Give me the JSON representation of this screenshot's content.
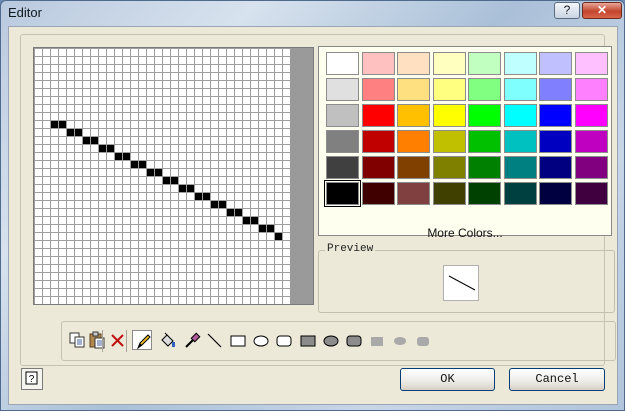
{
  "window": {
    "title": "Editor",
    "help_glyph": "?",
    "close_glyph": "✕"
  },
  "grid": {
    "cols": 32,
    "rows": 32,
    "filled": [
      [
        2,
        9
      ],
      [
        3,
        9
      ],
      [
        4,
        10
      ],
      [
        5,
        10
      ],
      [
        6,
        11
      ],
      [
        7,
        11
      ],
      [
        8,
        12
      ],
      [
        9,
        12
      ],
      [
        10,
        13
      ],
      [
        11,
        13
      ],
      [
        12,
        14
      ],
      [
        13,
        14
      ],
      [
        14,
        15
      ],
      [
        15,
        15
      ],
      [
        16,
        16
      ],
      [
        17,
        16
      ],
      [
        18,
        17
      ],
      [
        19,
        17
      ],
      [
        20,
        18
      ],
      [
        21,
        18
      ],
      [
        22,
        19
      ],
      [
        23,
        19
      ],
      [
        24,
        20
      ],
      [
        25,
        20
      ],
      [
        26,
        21
      ],
      [
        27,
        21
      ],
      [
        28,
        22
      ],
      [
        29,
        22
      ],
      [
        30,
        23
      ]
    ]
  },
  "palette": {
    "colors": [
      [
        "#ffffff",
        "#ffc0c0",
        "#ffe0c0",
        "#ffffc0",
        "#c0ffc0",
        "#c0ffff",
        "#c0c0ff",
        "#ffc0ff"
      ],
      [
        "#e0e0e0",
        "#ff8080",
        "#ffe080",
        "#ffff80",
        "#80ff80",
        "#80ffff",
        "#8080ff",
        "#ff80ff"
      ],
      [
        "#c0c0c0",
        "#ff0000",
        "#ffc000",
        "#ffff00",
        "#00ff00",
        "#00ffff",
        "#0000ff",
        "#ff00ff"
      ],
      [
        "#808080",
        "#c00000",
        "#ff8000",
        "#c0c000",
        "#00c000",
        "#00c0c0",
        "#0000c0",
        "#c000c0"
      ],
      [
        "#404040",
        "#800000",
        "#804000",
        "#808000",
        "#008000",
        "#008080",
        "#000080",
        "#800080"
      ],
      [
        "#000000",
        "#400000",
        "#804040",
        "#404000",
        "#004000",
        "#004040",
        "#000040",
        "#400040"
      ]
    ],
    "selected": [
      5,
      0
    ],
    "more_colors_label": "More Colors..."
  },
  "preview": {
    "label": "Preview"
  },
  "tools": [
    {
      "name": "copy-icon"
    },
    {
      "name": "paste-icon"
    },
    {
      "name": "clear-icon"
    },
    {
      "name": "pencil-icon",
      "active": true
    },
    {
      "name": "fill-bucket-icon"
    },
    {
      "name": "eyedropper-icon"
    },
    {
      "name": "line-tool-icon"
    },
    {
      "name": "rectangle-outline-icon"
    },
    {
      "name": "ellipse-outline-icon"
    },
    {
      "name": "rounded-rect-outline-icon"
    },
    {
      "name": "rectangle-filled-icon"
    },
    {
      "name": "ellipse-filled-icon"
    },
    {
      "name": "rounded-rect-filled-icon"
    },
    {
      "name": "rectangle-filled-light-icon"
    },
    {
      "name": "ellipse-filled-light-icon"
    },
    {
      "name": "rounded-rect-filled-light-icon"
    }
  ],
  "buttons": {
    "ok": "OK",
    "cancel": "Cancel",
    "help_glyph": "?"
  }
}
